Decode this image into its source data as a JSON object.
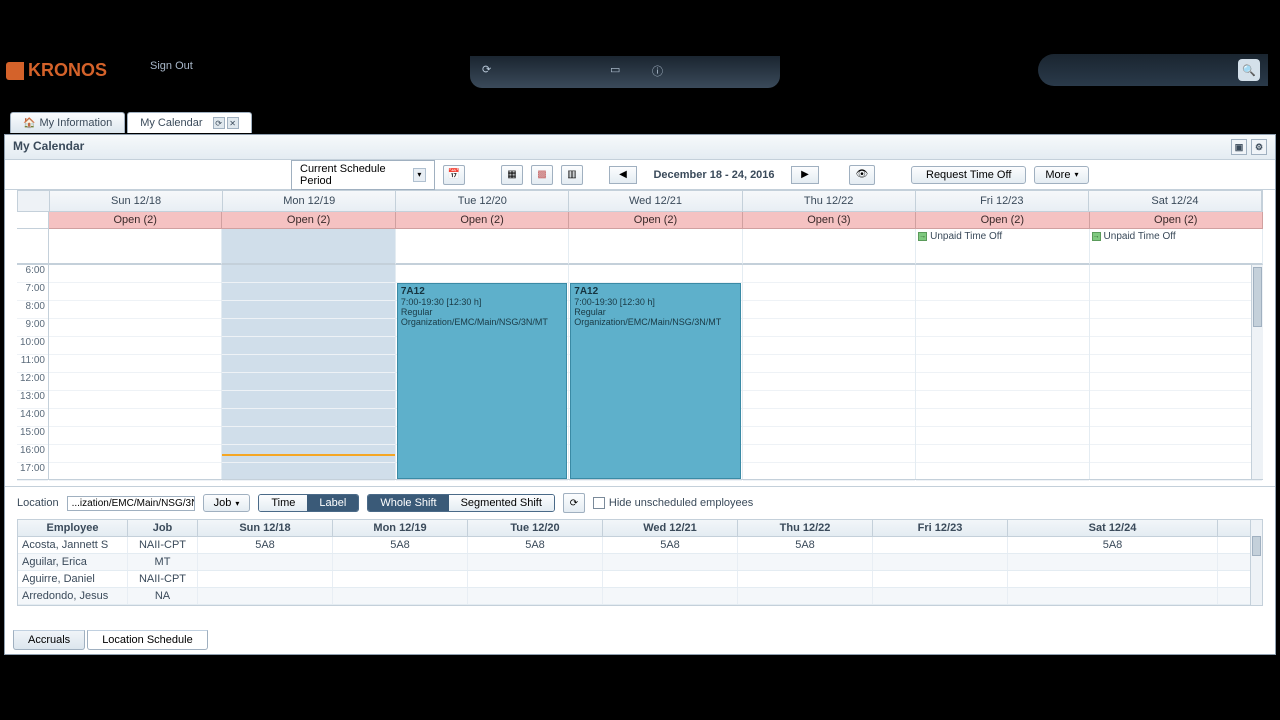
{
  "brand": "KRONOS",
  "user": {
    "name": "",
    "sign_out": "Sign Out"
  },
  "tabs": {
    "my_information": "My Information",
    "my_calendar": "My Calendar"
  },
  "panel_title": "My Calendar",
  "toolbar": {
    "period": "Current Schedule Period",
    "date_range": "December 18 - 24, 2016",
    "request_time_off": "Request Time Off",
    "more": "More"
  },
  "days": [
    {
      "label": "Sun 12/18",
      "open": "Open (2)"
    },
    {
      "label": "Mon 12/19",
      "open": "Open (2)"
    },
    {
      "label": "Tue 12/20",
      "open": "Open (2)"
    },
    {
      "label": "Wed 12/21",
      "open": "Open (2)"
    },
    {
      "label": "Thu 12/22",
      "open": "Open (3)"
    },
    {
      "label": "Fri 12/23",
      "open": "Open (2)"
    },
    {
      "label": "Sat 12/24",
      "open": "Open (2)"
    }
  ],
  "unpaid_time_off": "Unpaid Time Off",
  "hours": [
    "6:00",
    "7:00",
    "8:00",
    "9:00",
    "10:00",
    "11:00",
    "12:00",
    "13:00",
    "14:00",
    "15:00",
    "16:00",
    "17:00"
  ],
  "shift": {
    "code": "7A12",
    "time": "7:00-19:30 [12:30 h]",
    "type": "Regular",
    "org": "Organization/EMC/Main/NSG/3N/MT"
  },
  "location": {
    "label": "Location",
    "path": "...ization/EMC/Main/NSG/3N",
    "job": "Job",
    "time": "Time",
    "label_btn": "Label",
    "whole_shift": "Whole Shift",
    "segmented_shift": "Segmented Shift",
    "hide_unscheduled": "Hide unscheduled employees"
  },
  "emp_headers": [
    "Employee",
    "Job",
    "Sun 12/18",
    "Mon 12/19",
    "Tue 12/20",
    "Wed 12/21",
    "Thu 12/22",
    "Fri 12/23",
    "Sat 12/24"
  ],
  "emp_rows": [
    {
      "name": "Acosta, Jannett S",
      "job": "NAII-CPT",
      "cells": [
        "5A8",
        "5A8",
        "5A8",
        "5A8",
        "5A8",
        "",
        "5A8"
      ]
    },
    {
      "name": "Aguilar, Erica",
      "job": "MT",
      "cells": [
        "",
        "",
        "",
        "",
        "",
        "",
        ""
      ]
    },
    {
      "name": "Aguirre, Daniel",
      "job": "NAII-CPT",
      "cells": [
        "",
        "",
        "",
        "",
        "",
        "",
        ""
      ]
    },
    {
      "name": "Arredondo, Jesus",
      "job": "NA",
      "cells": [
        "",
        "",
        "",
        "",
        "",
        "",
        ""
      ]
    }
  ],
  "bottom_tabs": {
    "accruals": "Accruals",
    "location_schedule": "Location Schedule"
  }
}
